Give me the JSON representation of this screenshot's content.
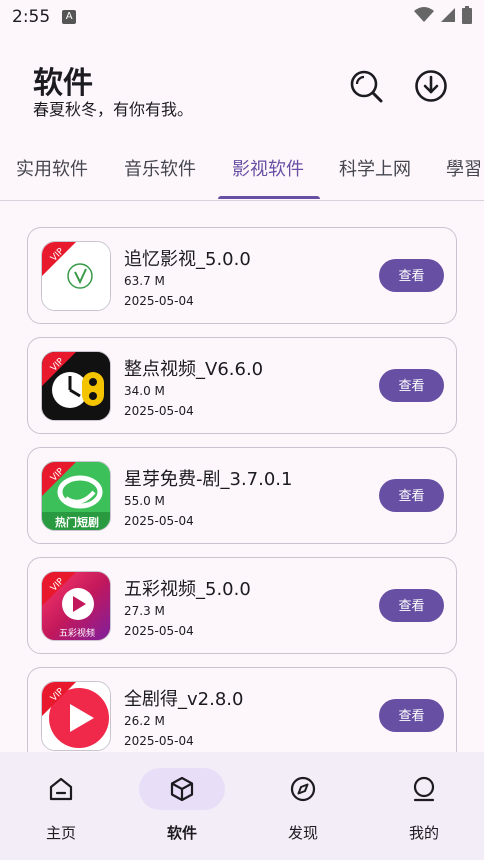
{
  "status_bar": {
    "time": "2:55",
    "badge": "A"
  },
  "header": {
    "title": "软件",
    "subtitle": "春夏秋冬，有你有我。"
  },
  "tabs": [
    {
      "label": "实用软件",
      "active": false
    },
    {
      "label": "音乐软件",
      "active": false
    },
    {
      "label": "影视软件",
      "active": true
    },
    {
      "label": "科学上网",
      "active": false
    },
    {
      "label": "學習",
      "active": false
    }
  ],
  "apps": [
    {
      "name": "追忆影视_5.0.0",
      "size": "63.7 M",
      "date": "2025-05-04",
      "button": "查看",
      "badge": "VIP",
      "icon": "zhuiyi-app-icon"
    },
    {
      "name": "整点视频_V6.6.0",
      "size": "34.0 M",
      "date": "2025-05-04",
      "button": "查看",
      "badge": "VIP",
      "icon": "zhengdian-app-icon"
    },
    {
      "name": "星芽免费-剧_3.7.0.1",
      "size": "55.0 M",
      "date": "2025-05-04",
      "button": "查看",
      "badge": "VIP",
      "icon_text": "热门短剧",
      "icon": "xingya-app-icon"
    },
    {
      "name": "五彩视频_5.0.0",
      "size": "27.3 M",
      "date": "2025-05-04",
      "button": "查看",
      "badge": "VIP",
      "icon_text": "五彩视频",
      "icon": "wucai-app-icon"
    },
    {
      "name": "全剧得_v2.8.0",
      "size": "26.2 M",
      "date": "2025-05-04",
      "button": "查看",
      "badge": "VIP",
      "icon": "quanjude-app-icon"
    }
  ],
  "bottom_nav": [
    {
      "label": "主页",
      "icon": "home-icon",
      "active": false
    },
    {
      "label": "软件",
      "icon": "box-icon",
      "active": true
    },
    {
      "label": "发现",
      "icon": "compass-icon",
      "active": false
    },
    {
      "label": "我的",
      "icon": "person-icon",
      "active": false
    }
  ],
  "colors": {
    "accent": "#6750a4",
    "background": "#fdf7fc",
    "nav_bg": "#f3edf7",
    "pill": "#e8def8"
  }
}
